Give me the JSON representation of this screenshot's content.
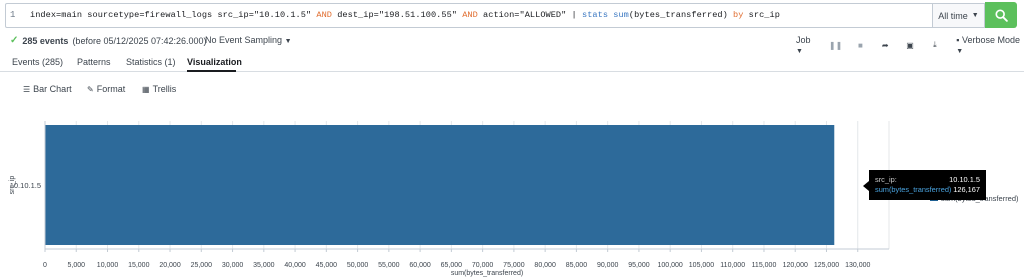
{
  "search": {
    "line_number": "1",
    "query_parts": [
      {
        "text": "index=main sourcetype=firewall_logs src_ip=\"10.10.1.5\" ",
        "kind": "plain"
      },
      {
        "text": "AND",
        "kind": "kw"
      },
      {
        "text": " dest_ip=\"198.51.100.55\" ",
        "kind": "plain"
      },
      {
        "text": "AND",
        "kind": "kw"
      },
      {
        "text": " action=\"ALLOWED\" | ",
        "kind": "plain"
      },
      {
        "text": "stats",
        "kind": "cmd"
      },
      {
        "text": " ",
        "kind": "plain"
      },
      {
        "text": "sum",
        "kind": "cmd"
      },
      {
        "text": "(bytes_transferred) ",
        "kind": "plain"
      },
      {
        "text": "by",
        "kind": "kw"
      },
      {
        "text": " src_ip",
        "kind": "plain"
      }
    ],
    "time_range": "All time",
    "search_button_icon": "search-icon"
  },
  "status": {
    "event_count": "285 events",
    "event_time": "(before 05/12/2025 07:42:26.000)",
    "sampling": "No Event Sampling",
    "job": "Job",
    "mode": "Verbose Mode"
  },
  "tabs": [
    {
      "label": "Events (285)",
      "active": false
    },
    {
      "label": "Patterns",
      "active": false
    },
    {
      "label": "Statistics (1)",
      "active": false
    },
    {
      "label": "Visualization",
      "active": true
    }
  ],
  "viz_toolbar": {
    "chart_type": "Bar Chart",
    "format": "Format",
    "trellis": "Trellis"
  },
  "chart_data": {
    "type": "bar",
    "orientation": "horizontal",
    "categories": [
      "10.10.1.5"
    ],
    "series": [
      {
        "name": "sum(bytes_transferred)",
        "values": [
          126167
        ]
      }
    ],
    "xlabel": "sum(bytes_transferred)",
    "ylabel": "src_ip",
    "xlim": [
      0,
      135000
    ],
    "x_ticks": [
      0,
      5000,
      10000,
      15000,
      20000,
      25000,
      30000,
      35000,
      40000,
      45000,
      50000,
      55000,
      60000,
      65000,
      70000,
      75000,
      80000,
      85000,
      90000,
      95000,
      100000,
      105000,
      110000,
      115000,
      120000,
      125000,
      130000
    ],
    "x_tick_labels": [
      "0",
      "5,000",
      "10,000",
      "15,000",
      "20,000",
      "25,000",
      "30,000",
      "35,000",
      "40,000",
      "45,000",
      "50,000",
      "55,000",
      "60,000",
      "65,000",
      "70,000",
      "75,000",
      "80,000",
      "85,000",
      "90,000",
      "95,000",
      "100,000",
      "105,000",
      "110,000",
      "115,000",
      "120,000",
      "125,000",
      "130,000"
    ],
    "bar_color": "#2d6a9a",
    "grid": true,
    "legend_position": "right"
  },
  "tooltip": {
    "category_label": "src_ip:",
    "category_value": "10.10.1.5",
    "series_label": "sum(bytes_transferred)",
    "series_value": "126,167"
  },
  "legend": {
    "label": "sum(bytes_transferred)"
  }
}
